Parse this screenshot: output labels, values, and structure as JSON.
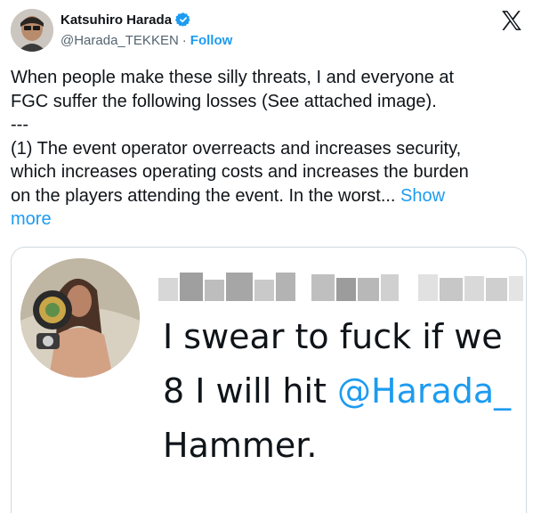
{
  "author": {
    "display_name": "Katsuhiro Harada",
    "handle": "@Harada_TEKKEN",
    "separator": "·",
    "follow_label": "Follow"
  },
  "tweet": {
    "line1": "When people make these silly threats, I and everyone at",
    "line2": "FGC suffer the following losses (See attached image).",
    "line3": "---",
    "line4": "(1) The event operator overreacts and increases security,",
    "line5": "which increases operating costs and increases the burden",
    "line6_text": "on the players attending the event. In the worst... ",
    "line6_link": "Show",
    "line7_link": "more"
  },
  "media": {
    "line1": "I swear to fuck if we",
    "line2_prefix": "8 I will hit ",
    "line2_mention": "@Harada_",
    "line3": "Hammer."
  },
  "colors": {
    "accent": "#1d9bf0",
    "text": "#0f1419",
    "secondary": "#536471",
    "border": "#cfd9de"
  },
  "icons": {
    "verified": "verified-badge-icon",
    "brand": "x-logo-icon"
  }
}
